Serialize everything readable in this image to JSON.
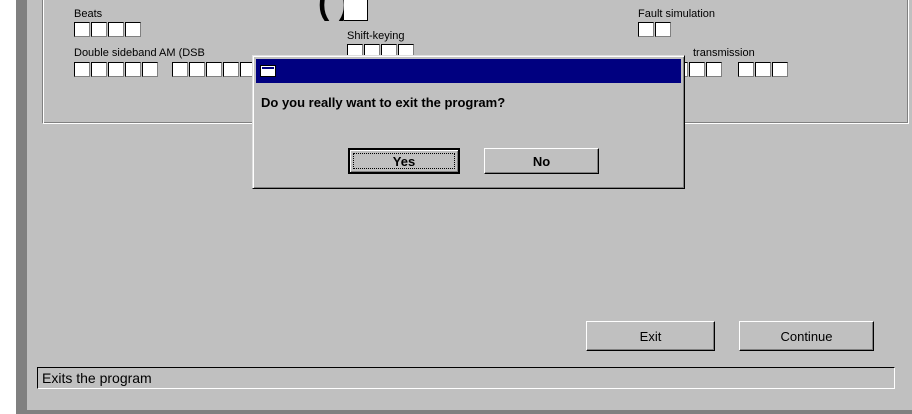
{
  "header": {
    "title_glyphs": "(   )"
  },
  "settings": {
    "beats_label": "Beats",
    "dsb_label": "Double sideband AM (DSB",
    "shift_keying_label": "Shift-keying",
    "fault_label": "Fault simulation",
    "transmission_label": "transmission"
  },
  "buttons": {
    "exit": "Exit",
    "continue": "Continue"
  },
  "status_bar": {
    "text": "Exits the program"
  },
  "dialog": {
    "title": "",
    "message": "Do you really want to exit the program?",
    "yes": "Yes",
    "no": "No"
  }
}
